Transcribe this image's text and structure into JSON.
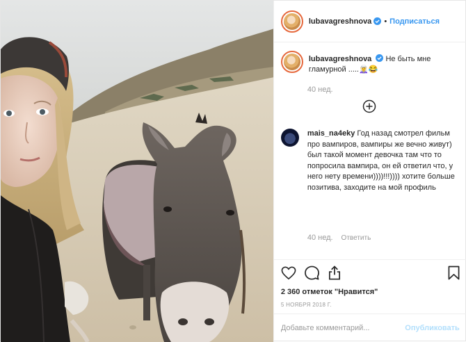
{
  "post": {
    "author": "lubavagreshnova",
    "follow_label": "Подписаться",
    "caption_text": "Не быть мне гламурной .....🧝‍♀️😂",
    "caption_time": "40 нед.",
    "load_more_icon": "plus-circle-icon",
    "verified_icon": "verified-badge-icon",
    "accent_color": "#3897f0"
  },
  "comments": [
    {
      "username": "mais_na4eky",
      "text": "Год назад смотрел фильм про вампиров, вампиры же вечно живут) был такой момент девочка там что то попросила вампира, он ей ответил что, у него нету времени))))!!!)))) хотите больше позитива, заходите на мой профиль",
      "time": "40 нед.",
      "reply_label": "Ответить"
    }
  ],
  "actions": {
    "like_icon": "heart-icon",
    "comment_icon": "comment-icon",
    "share_icon": "share-icon",
    "save_icon": "bookmark-icon",
    "likes_text": "2 360 отметок \"Нравится\"",
    "date": "5 ноября 2018 г."
  },
  "composer": {
    "placeholder": "Добавьте комментарий...",
    "publish_label": "Опубликовать"
  }
}
